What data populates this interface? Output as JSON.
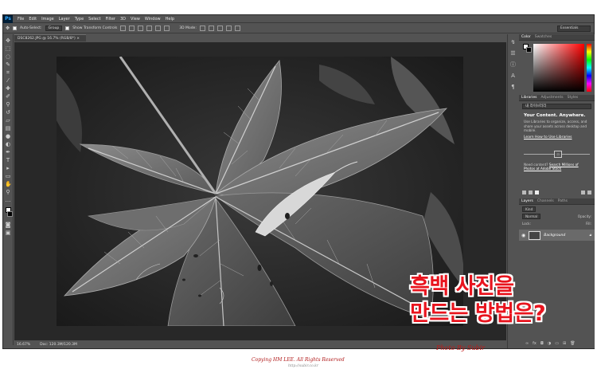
{
  "app": {
    "logo": "Ps"
  },
  "menu": [
    "File",
    "Edit",
    "Image",
    "Layer",
    "Type",
    "Select",
    "Filter",
    "3D",
    "View",
    "Window",
    "Help"
  ],
  "options": {
    "auto_select": "Auto-Select:",
    "group_value": "Group",
    "show_transform": "Show Transform Controls",
    "mode_3d": "3D Mode:",
    "workspace": "Essentials"
  },
  "document": {
    "tab_label": "DSC8262.JPG @ 16.7% (RGB/8*) ×",
    "zoom": "16.67%",
    "doc_size": "Doc: 120.3M/120.3M"
  },
  "panels": {
    "color_tabs": [
      "Color",
      "Swatches"
    ],
    "library_tabs": [
      "Libraries",
      "Adjustments",
      "Styles"
    ],
    "library_select": "내 라이브러리",
    "library_heading": "Your Content. Anywhere.",
    "library_text": "Use Libraries to organize, access, and share your assets across desktop and mobile.",
    "library_link": "Learn How to Use Libraries",
    "library_stock_prefix": "Need content? ",
    "library_stock_link": "Search Millions of Photos at Adobe Stock",
    "layers_tabs": [
      "Layers",
      "Channels",
      "Paths"
    ],
    "kind": "Kind",
    "blend_mode": "Normal",
    "opacity": "Opacity:",
    "lock": "Lock:",
    "fill": "Fill:",
    "layer_name": "Background"
  },
  "overlay": {
    "line1": "흑백 사진을",
    "line2": "만드는 방법은?",
    "photo_credit": "Photo By Subir",
    "copyright": "Copying HM LEE. All Rights Reserved",
    "copyright_url": "http://subir.co.kr"
  },
  "colors": {
    "accent_red": "#e8141e",
    "ps_blue": "#31a8ff"
  }
}
